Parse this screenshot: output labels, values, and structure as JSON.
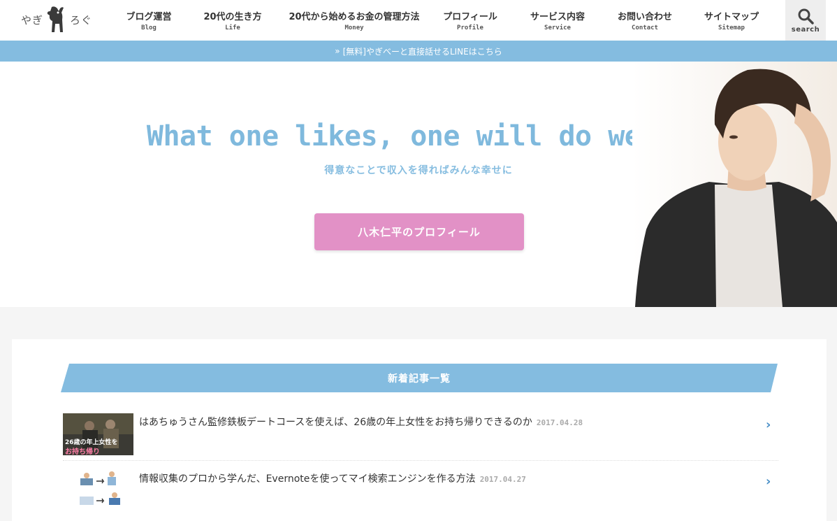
{
  "logo": {
    "left": "やぎ",
    "right": "ろぐ"
  },
  "nav": [
    {
      "ja": "ブログ運営",
      "en": "Blog",
      "w": 106
    },
    {
      "ja": "20代の生き方",
      "en": "Life",
      "w": 134
    },
    {
      "ja": "20代から始めるお金の管理方法",
      "en": "Money",
      "w": 214
    },
    {
      "ja": "プロフィール",
      "en": "Profile",
      "w": 118
    },
    {
      "ja": "サービス内容",
      "en": "Service",
      "w": 132
    },
    {
      "ja": "お問い合わせ",
      "en": "Contact",
      "w": 118
    },
    {
      "ja": "サイトマップ",
      "en": "Sitemap",
      "w": 130
    }
  ],
  "search": {
    "label": "search"
  },
  "notice": {
    "arrow": "»",
    "text": "[無料]やぎべーと直接話せるLINEはこちら"
  },
  "hero": {
    "title": "What one likes, one will do well.",
    "subtitle": "得意なことで収入を得ればみんな幸せに",
    "button": "八木仁平のプロフィール"
  },
  "articles_section": {
    "title": "新着記事一覧",
    "items": [
      {
        "title": "はあちゅうさん監修鉄板デートコースを使えば、26歳の年上女性をお持ち帰りできるのか",
        "date": "2017.04.28",
        "thumb_text_1": "26歳の年上女性を",
        "thumb_text_2": "お持ち帰り"
      },
      {
        "title": "情報収集のプロから学んだ、Evernoteを使ってマイ検索エンジンを作る方法",
        "date": "2017.04.27"
      }
    ]
  },
  "colors": {
    "accent": "#84bce0",
    "pink": "#e291c6",
    "title_blue": "#7fb9dd"
  }
}
